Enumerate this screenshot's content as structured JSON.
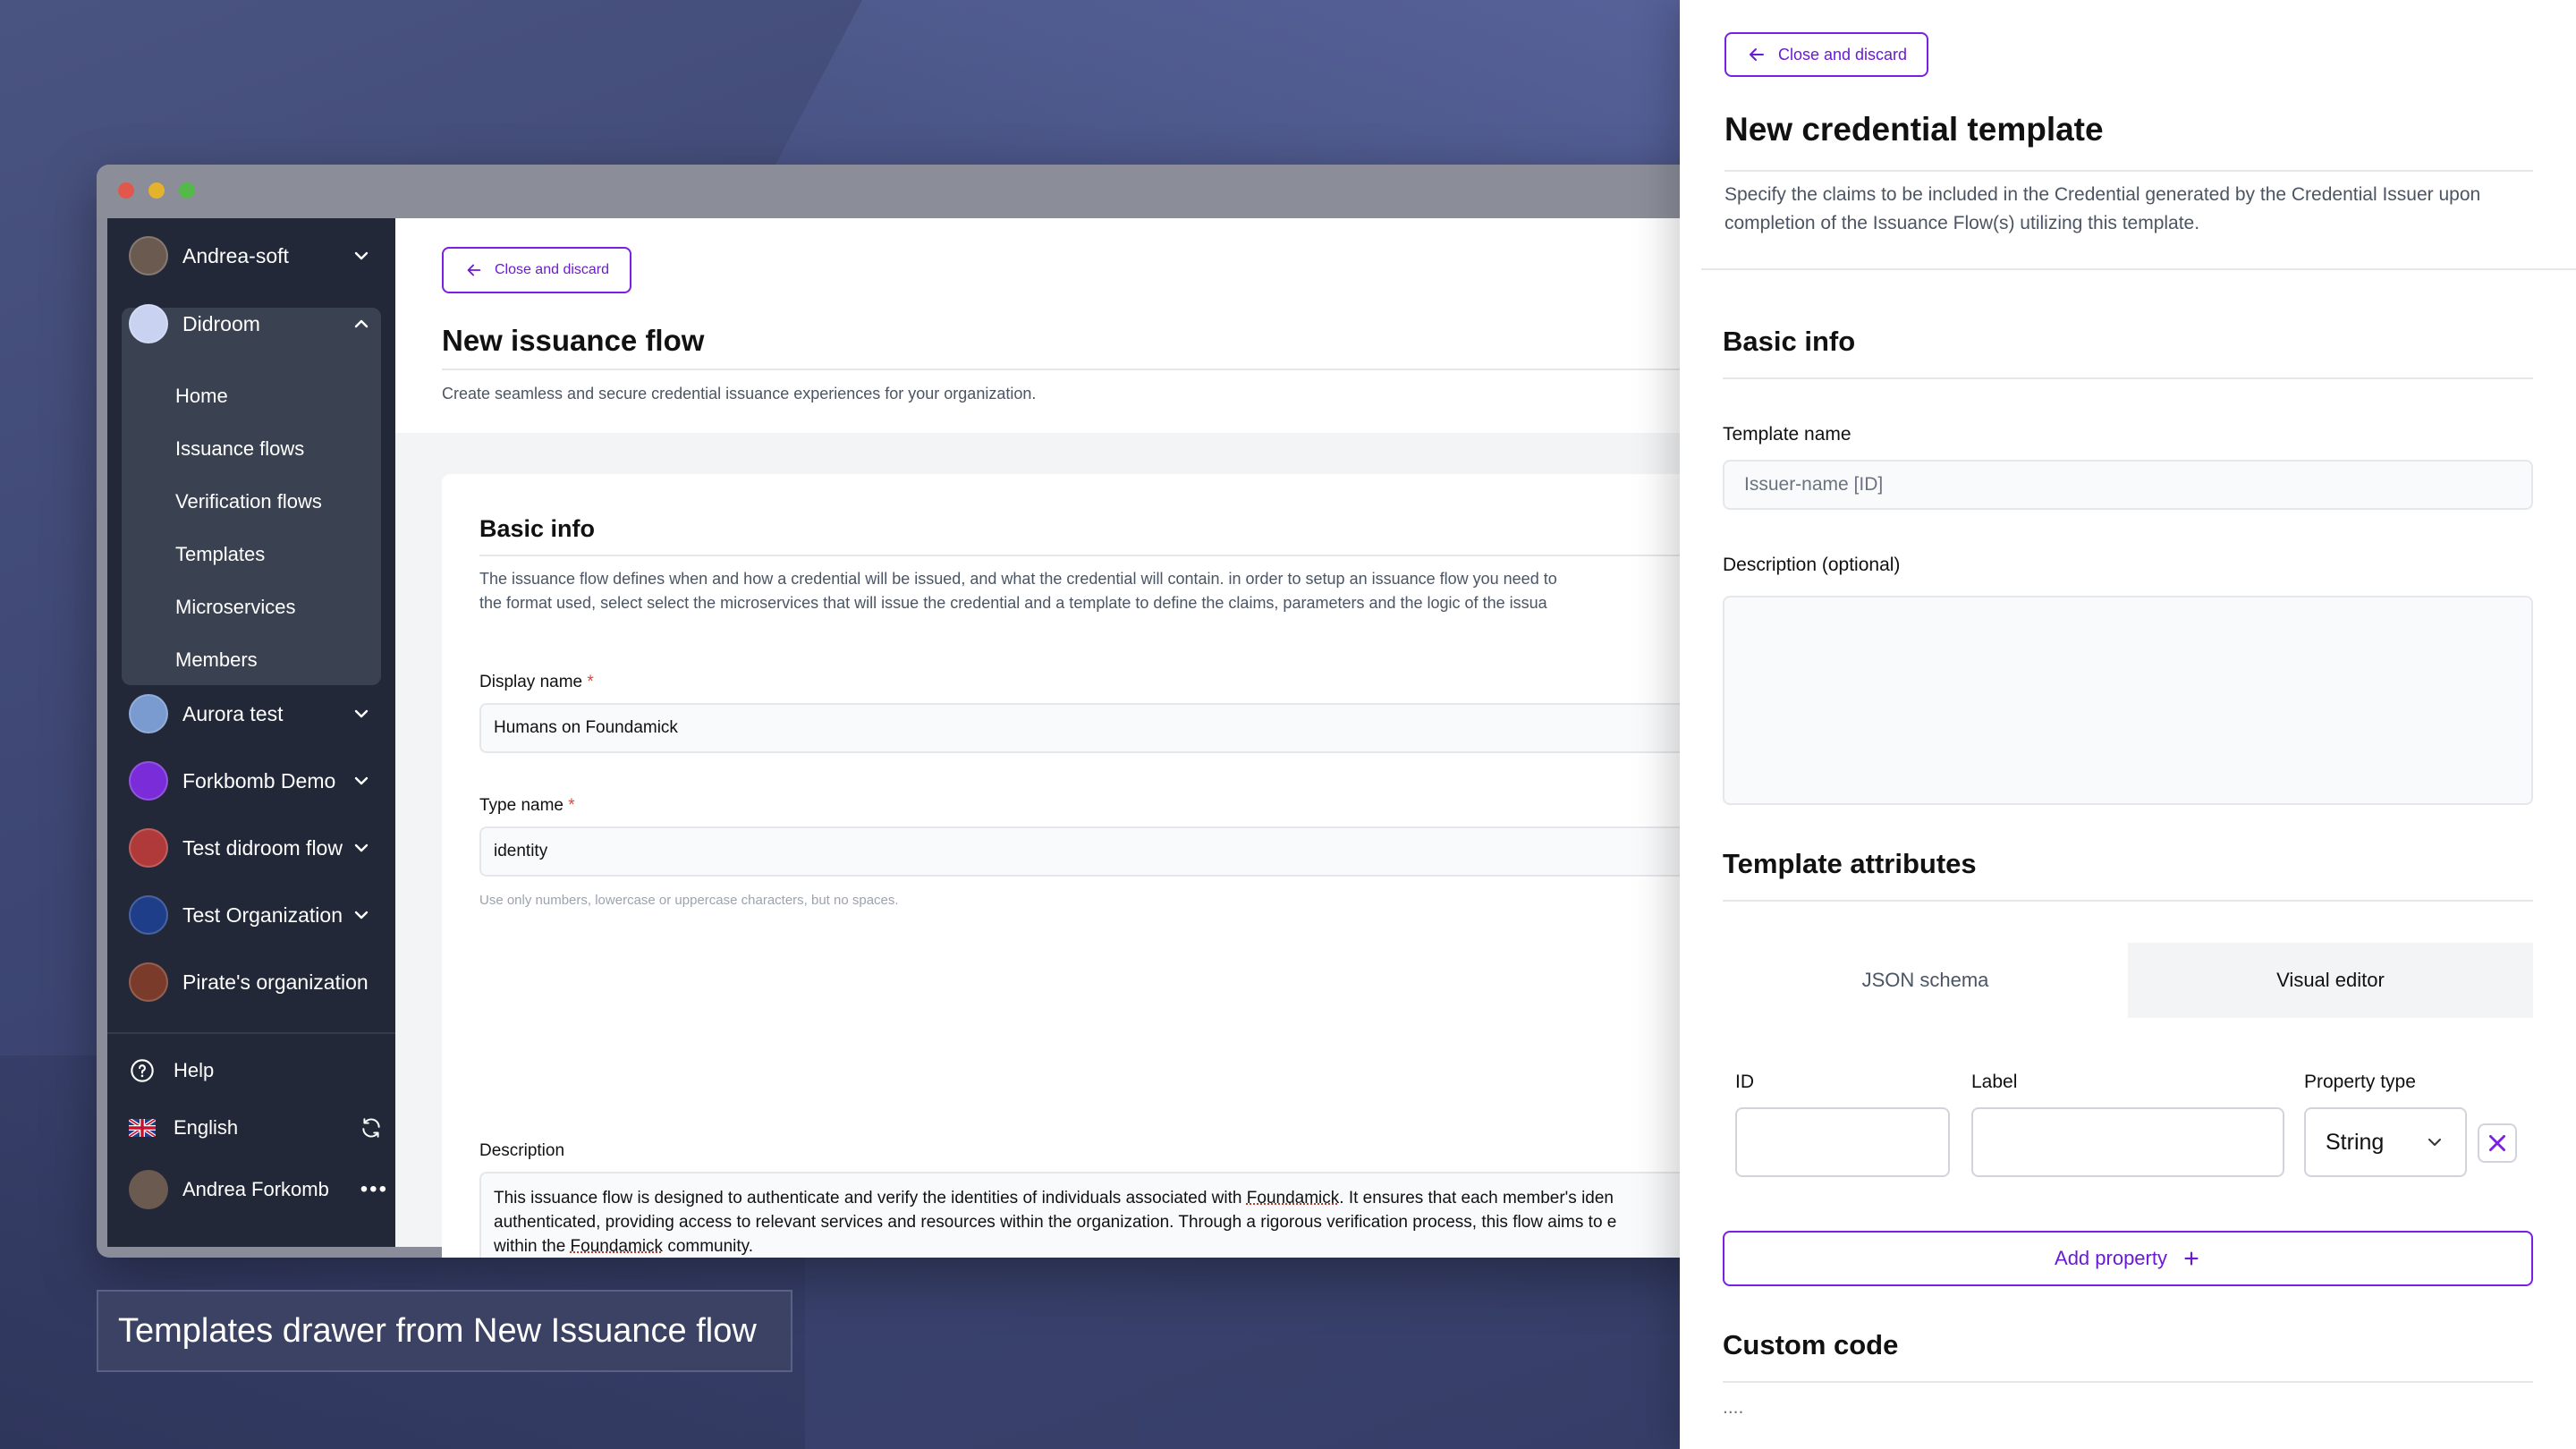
{
  "caption": "Templates drawer from New Issuance flow",
  "sidebar": {
    "orgs": [
      {
        "label": "Andrea-soft",
        "avatar_color": "#6b5a50"
      },
      {
        "label": "Didroom",
        "avatar_color": "#c9d2f0"
      },
      {
        "label": "Aurora test",
        "avatar_color": "#7a9bd0"
      },
      {
        "label": "Forkbomb Demo",
        "avatar_color": "#7b2cd9"
      },
      {
        "label": "Test didroom flow",
        "avatar_color": "#b03a3a"
      },
      {
        "label": "Test Organization",
        "avatar_color": "#1f3e8a"
      },
      {
        "label": "Pirate's organization",
        "avatar_color": "#7a3b2a"
      }
    ],
    "sub_items": [
      "Home",
      "Issuance flows",
      "Verification flows",
      "Templates",
      "Microservices",
      "Members"
    ],
    "footer": {
      "help": "Help",
      "language": "English",
      "user": "Andrea Forkomb"
    }
  },
  "main": {
    "close_label": "Close and discard",
    "title": "New issuance flow",
    "subtitle": "Create seamless and secure credential issuance experiences for your organization.",
    "card": {
      "title": "Basic info",
      "desc_line1": "The issuance flow defines when and how a credential will be issued, and what the credential will contain. in order to setup an issuance flow you need to",
      "desc_line2": "the format used, select select the microservices that will issue the credential and a template to define the claims, parameters and the logic of the issua",
      "display_name_label": "Display name",
      "display_name_value": "Humans on Foundamick",
      "type_name_label": "Type name",
      "type_name_value": "identity",
      "type_name_hint": "Use only numbers, lowercase or uppercase characters, but no spaces.",
      "description_label": "Description",
      "description_p1": "This issuance flow is designed to authenticate and verify the identities of individuals associated with ",
      "description_u1": "Foundamick",
      "description_p2": ". It ensures that each member's iden\nauthenticated, providing access to relevant services and resources within the organization. Through a rigorous verification process, this flow aims to e\nwithin the ",
      "description_u2": "Foundamick",
      "description_p3": " community.",
      "required_mark": "*"
    }
  },
  "drawer": {
    "close_label": "Close and discard",
    "title": "New credential template",
    "description": "Specify the claims to be included in the Credential generated by the Credential Issuer upon completion of the Issuance Flow(s) utilizing this template.",
    "basic_info": "Basic info",
    "template_name_label": "Template name",
    "template_name_placeholder": "Issuer-name [ID]",
    "description_label": "Description (optional)",
    "attributes_title": "Template attributes",
    "tabs": [
      "JSON schema",
      "Visual editor"
    ],
    "attr_id_label": "ID",
    "attr_label_label": "Label",
    "attr_type_label": "Property type",
    "attr_type_value": "String",
    "add_property": "Add property",
    "custom_code": "Custom code",
    "custom_code_value": "...."
  },
  "colors": {
    "accent": "#7b1fe0",
    "sidebar_bg": "#222838",
    "required": "#e0483a"
  }
}
